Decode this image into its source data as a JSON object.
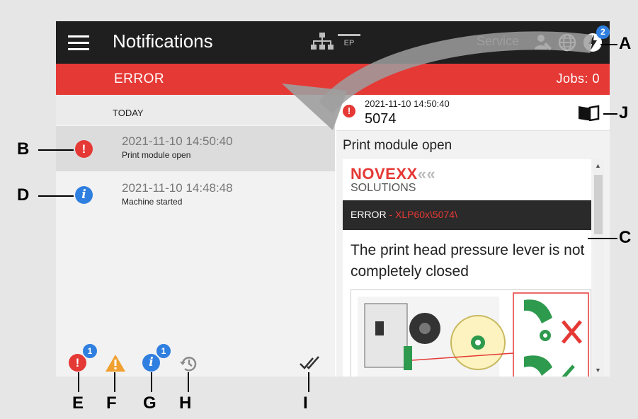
{
  "topbar": {
    "title": "Notifications",
    "ep_label": "EP",
    "service_label": "Service",
    "notifications_count": "2"
  },
  "status": {
    "error_label": "ERROR",
    "jobs_label": "Jobs: 0"
  },
  "list": {
    "section": "TODAY",
    "items": [
      {
        "time": "2021-11-10 14:50:40",
        "message": "Print module open",
        "type": "error"
      },
      {
        "time": "2021-11-10 14:48:48",
        "message": "Machine started",
        "type": "info"
      }
    ]
  },
  "filters": {
    "error_count": "1",
    "info_count": "1"
  },
  "detail": {
    "time": "2021-11-10 14:50:40",
    "code": "5074",
    "title": "Print module open",
    "brand_line1": "NOVEXX",
    "brand_line2": "SOLUTIONS",
    "bar_label": "ERROR",
    "bar_path": " - XLP60x\\5074\\",
    "text": "The print head pressure lever is not completely closed"
  },
  "callouts": {
    "a": "A",
    "b": "B",
    "c": "C",
    "d": "D",
    "e": "E",
    "f": "F",
    "g": "G",
    "h": "H",
    "i": "I",
    "j": "J"
  },
  "colors": {
    "error_red": "#e53935",
    "info_blue": "#2f7fe0",
    "warning_orange": "#f0a030",
    "topbar": "#1f1f1f"
  }
}
